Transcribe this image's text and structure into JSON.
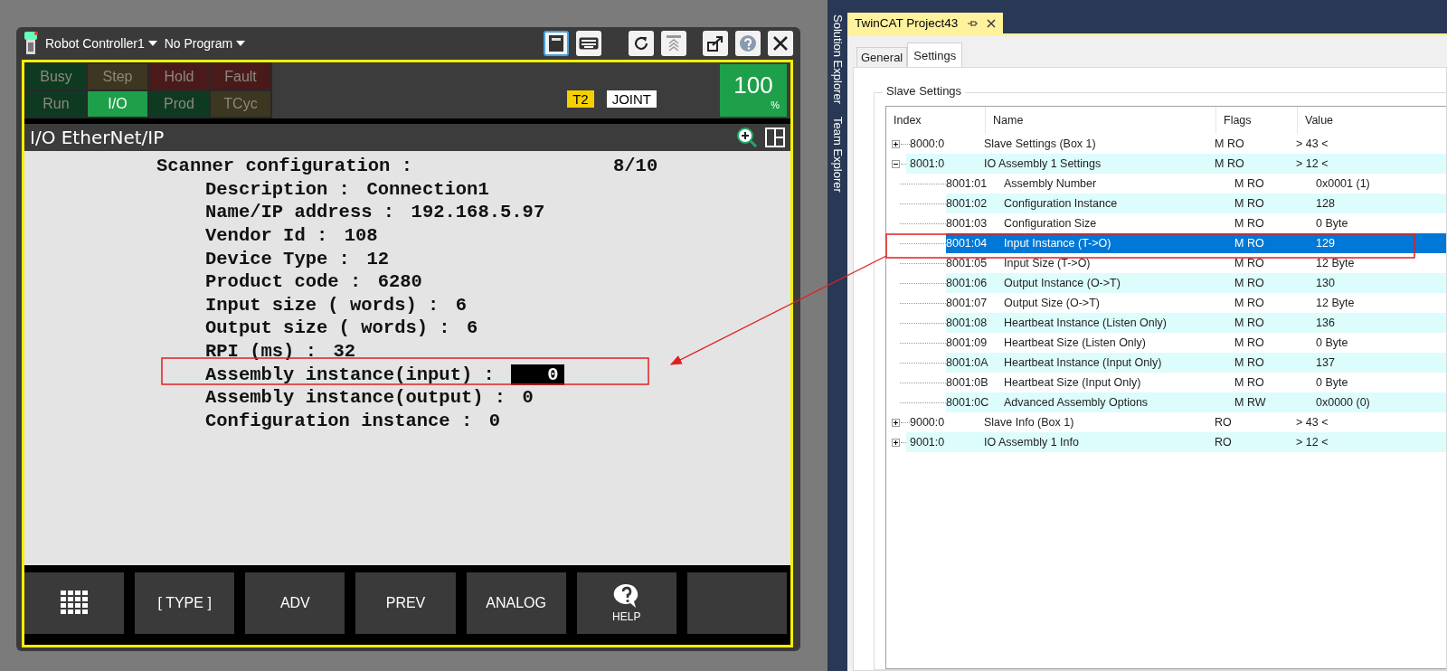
{
  "pendant": {
    "controller": "Robot Controller1",
    "program": "No Program",
    "status_flags": [
      {
        "label": "Busy",
        "on": false,
        "color": "#0f3a22"
      },
      {
        "label": "Step",
        "on": false,
        "color": "#3d3620"
      },
      {
        "label": "Hold",
        "on": false,
        "color": "#4a1a1a"
      },
      {
        "label": "Fault",
        "on": false,
        "color": "#4a1a1a"
      },
      {
        "label": "Run",
        "on": false,
        "color": "#0f3a22"
      },
      {
        "label": "I/O",
        "on": true,
        "color": "#1ea04a"
      },
      {
        "label": "Prod",
        "on": false,
        "color": "#0f3a22"
      },
      {
        "label": "TCyc",
        "on": false,
        "color": "#3d3620"
      }
    ],
    "mode_badge": "T2",
    "coord_badge": "JOINT",
    "override": "100",
    "override_unit": "%",
    "screen_title": "I/O EtherNet/IP",
    "lines": [
      {
        "kind": "header",
        "label": "Scanner configuration :",
        "value": "8/10",
        "selected": false
      },
      {
        "kind": "item",
        "label": "Description :",
        "value": "Connection1",
        "selected": false
      },
      {
        "kind": "item",
        "label": "Name/IP address :",
        "value": "192.168.5.97",
        "selected": false
      },
      {
        "kind": "item",
        "label": "Vendor Id :",
        "value": "108",
        "selected": false
      },
      {
        "kind": "item",
        "label": "Device Type :",
        "value": "12",
        "selected": false
      },
      {
        "kind": "item",
        "label": "Product code :",
        "value": "6280",
        "selected": false
      },
      {
        "kind": "item",
        "label": "Input size ( words) :",
        "value": "6",
        "selected": false
      },
      {
        "kind": "item",
        "label": "Output size ( words) :",
        "value": "6",
        "selected": false
      },
      {
        "kind": "item",
        "label": "RPI (ms) :",
        "value": "32",
        "selected": false
      },
      {
        "kind": "item",
        "label": "Assembly instance(input) :",
        "value": "0",
        "selected": true
      },
      {
        "kind": "item",
        "label": "Assembly instance(output) :",
        "value": "0",
        "selected": false
      },
      {
        "kind": "item",
        "label": "Configuration instance :",
        "value": "0",
        "selected": false
      }
    ],
    "function_keys": [
      {
        "kind": "menu"
      },
      {
        "kind": "text",
        "label": "[ TYPE ]"
      },
      {
        "kind": "text",
        "label": "ADV"
      },
      {
        "kind": "text",
        "label": "PREV"
      },
      {
        "kind": "text",
        "label": "ANALOG"
      },
      {
        "kind": "help",
        "label": "HELP"
      },
      {
        "kind": "blank"
      }
    ]
  },
  "twincat": {
    "side_tabs": [
      "Solution Explorer",
      "Team Explorer"
    ],
    "document_tab": "TwinCAT Project43",
    "tabs": [
      {
        "label": "General",
        "selected": false
      },
      {
        "label": "Settings",
        "selected": true
      }
    ],
    "group_title": "Slave Settings",
    "columns": [
      "Index",
      "Name",
      "Flags",
      "Value"
    ],
    "rows": [
      {
        "index": "8000:0",
        "name": "Slave Settings (Box 1)",
        "flags": "M RO",
        "value": "> 43 <",
        "expanded": false,
        "selected": false
      },
      {
        "index": "8001:0",
        "name": "IO Assembly 1 Settings",
        "flags": "M RO",
        "value": "> 12 <",
        "expanded": true,
        "selected": false,
        "children": [
          {
            "index": "8001:01",
            "name": "Assembly Number",
            "flags": "M RO",
            "value": "0x0001 (1)",
            "selected": false
          },
          {
            "index": "8001:02",
            "name": "Configuration Instance",
            "flags": "M RO",
            "value": "128",
            "selected": false
          },
          {
            "index": "8001:03",
            "name": "Configuration Size",
            "flags": "M RO",
            "value": "0 Byte",
            "selected": false
          },
          {
            "index": "8001:04",
            "name": "Input Instance (T->O)",
            "flags": "M RO",
            "value": "129",
            "selected": true
          },
          {
            "index": "8001:05",
            "name": "Input Size (T->O)",
            "flags": "M RO",
            "value": "12 Byte",
            "selected": false
          },
          {
            "index": "8001:06",
            "name": "Output Instance (O->T)",
            "flags": "M RO",
            "value": "130",
            "selected": false
          },
          {
            "index": "8001:07",
            "name": "Output Size (O->T)",
            "flags": "M RO",
            "value": "12 Byte",
            "selected": false
          },
          {
            "index": "8001:08",
            "name": "Heartbeat Instance (Listen Only)",
            "flags": "M RO",
            "value": "136",
            "selected": false
          },
          {
            "index": "8001:09",
            "name": "Heartbeat Size (Listen Only)",
            "flags": "M RO",
            "value": "0 Byte",
            "selected": false
          },
          {
            "index": "8001:0A",
            "name": "Heartbeat Instance (Input Only)",
            "flags": "M RO",
            "value": "137",
            "selected": false
          },
          {
            "index": "8001:0B",
            "name": "Heartbeat Size (Input Only)",
            "flags": "M RO",
            "value": "0 Byte",
            "selected": false
          },
          {
            "index": "8001:0C",
            "name": "Advanced Assembly Options",
            "flags": "M RW",
            "value": "0x0000 (0)",
            "selected": false
          }
        ]
      },
      {
        "index": "9000:0",
        "name": "Slave Info (Box 1)",
        "flags": "RO",
        "value": "> 43 <",
        "expanded": false,
        "selected": false
      },
      {
        "index": "9001:0",
        "name": "IO Assembly 1 Info",
        "flags": "RO",
        "value": "> 12 <",
        "expanded": false,
        "selected": false
      }
    ]
  }
}
